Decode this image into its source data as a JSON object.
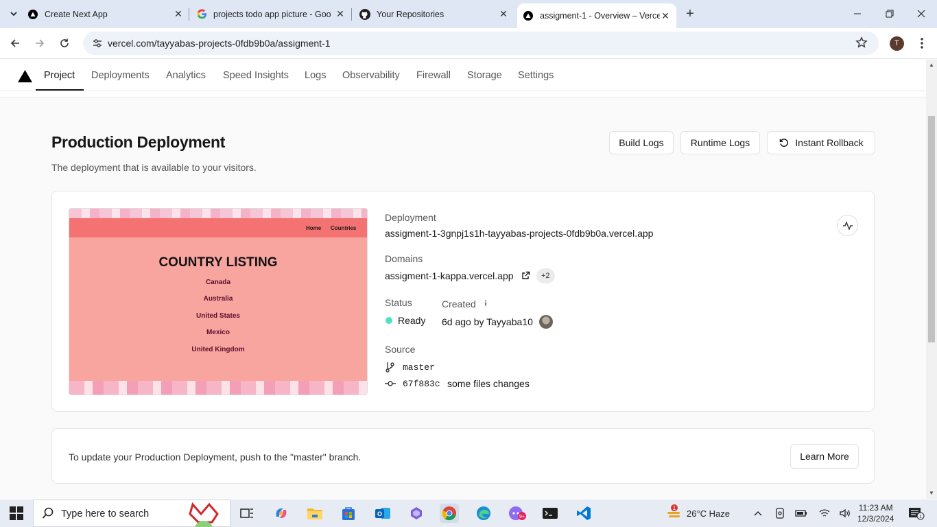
{
  "browser": {
    "tabs": [
      {
        "title": "Create Next App",
        "icon": "vercel-triangle-icon"
      },
      {
        "title": "projects todo app picture - Goo",
        "icon": "google-icon"
      },
      {
        "title": "Your Repositories",
        "icon": "github-icon"
      },
      {
        "title": "assigment-1 - Overview – Verce",
        "icon": "vercel-triangle-icon",
        "active": true
      }
    ],
    "url": "vercel.com/tayyabas-projects-0fdb9b0a/assigment-1",
    "profile_initial": "T"
  },
  "project_nav": {
    "items": [
      "Project",
      "Deployments",
      "Analytics",
      "Speed Insights",
      "Logs",
      "Observability",
      "Firewall",
      "Storage",
      "Settings"
    ],
    "active": "Project"
  },
  "page": {
    "title": "Production Deployment",
    "subtitle": "The deployment that is available to your visitors.",
    "buttons": {
      "build_logs": "Build Logs",
      "runtime_logs": "Runtime Logs",
      "instant_rollback": "Instant Rollback"
    }
  },
  "deployment": {
    "preview": {
      "nav_links": [
        "Home",
        "Countries"
      ],
      "heading": "COUNTRY LISTING",
      "countries": [
        "Canada",
        "Australia",
        "United States",
        "Mexico",
        "United Kingdom"
      ]
    },
    "deployment_label": "Deployment",
    "deployment_url": "assigment-1-3gnpj1s1h-tayyabas-projects-0fdb9b0a.vercel.app",
    "domains_label": "Domains",
    "domain": "assigment-1-kappa.vercel.app",
    "extra_domains": "+2",
    "status_label": "Status",
    "status": "Ready",
    "status_color": "#50e3c2",
    "created_label": "Created",
    "created": "6d ago by Tayyaba10",
    "source_label": "Source",
    "branch": "master",
    "commit_hash": "67f883c",
    "commit_message": "some files changes"
  },
  "update_card": {
    "message": "To update your Production Deployment, push to the \"master\" branch.",
    "learn_more": "Learn More"
  },
  "taskbar": {
    "search_placeholder": "Type here to search",
    "weather": "26°C  Haze",
    "time": "11:23 AM",
    "date": "12/3/2024",
    "notification_count": "1"
  }
}
